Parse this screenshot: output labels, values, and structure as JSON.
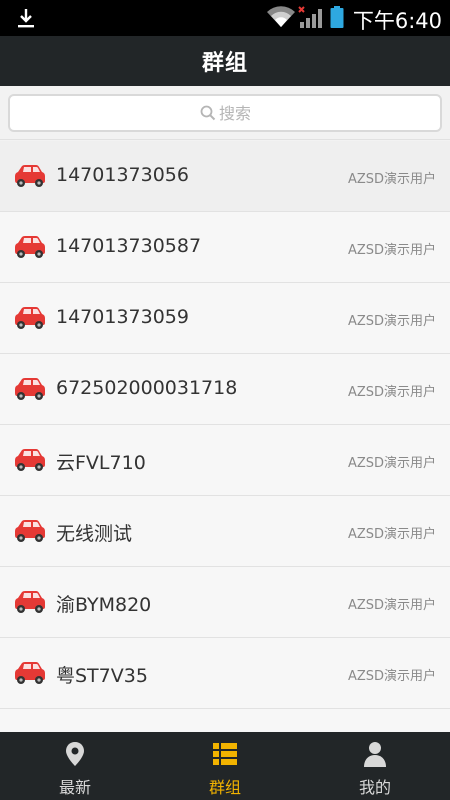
{
  "status_bar": {
    "time": "下午6:40",
    "icons": [
      "download-icon",
      "wifi-icon",
      "signal-icon",
      "battery-icon"
    ]
  },
  "header": {
    "title": "群组"
  },
  "search": {
    "placeholder": "搜索"
  },
  "vehicles": [
    {
      "name": "14701373056",
      "owner": "AZSD演示用户"
    },
    {
      "name": "147013730587",
      "owner": "AZSD演示用户"
    },
    {
      "name": "14701373059",
      "owner": "AZSD演示用户"
    },
    {
      "name": "672502000031718",
      "owner": "AZSD演示用户"
    },
    {
      "name": "云FVL710",
      "owner": "AZSD演示用户"
    },
    {
      "name": "无线测试",
      "owner": "AZSD演示用户"
    },
    {
      "name": "渝BYM820",
      "owner": "AZSD演示用户"
    },
    {
      "name": "粤ST7V35",
      "owner": "AZSD演示用户"
    }
  ],
  "bottom_nav": {
    "items": [
      {
        "label": "最新",
        "icon": "location-pin-icon",
        "active": false
      },
      {
        "label": "群组",
        "icon": "list-icon",
        "active": true
      },
      {
        "label": "我的",
        "icon": "user-icon",
        "active": false
      }
    ]
  },
  "colors": {
    "accent": "#f2b300",
    "header_bg": "#222628",
    "car_red": "#e53935"
  }
}
